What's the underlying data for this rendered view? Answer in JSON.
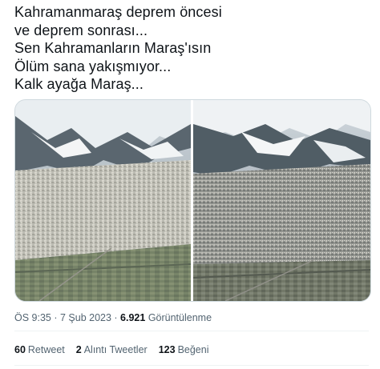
{
  "tweet": {
    "lines": [
      "Kahramanmaraş deprem öncesi",
      "ve deprem sonrası...",
      "Sen Kahramanların Maraş'ısın",
      "Ölüm sana yakışmıyor...",
      "Kalk ayağa Maraş..."
    ]
  },
  "media": {
    "left_photo": "aerial-city-before-earthquake",
    "right_photo": "aerial-city-after-earthquake"
  },
  "meta": {
    "time": "ÖS 9:35",
    "separator1": " · ",
    "date": "7 Şub 2023",
    "separator2": " · ",
    "views": "6.921",
    "views_label": "Görüntülenme"
  },
  "stats": {
    "retweets": {
      "count": "60",
      "label": "Retweet"
    },
    "quotes": {
      "count": "2",
      "label": "Alıntı Tweetler"
    },
    "likes": {
      "count": "123",
      "label": "Beğeni"
    }
  },
  "colors": {
    "text": "#0f1419",
    "secondary": "#536471",
    "border": "#cfd9de",
    "divider": "#eff3f4"
  }
}
